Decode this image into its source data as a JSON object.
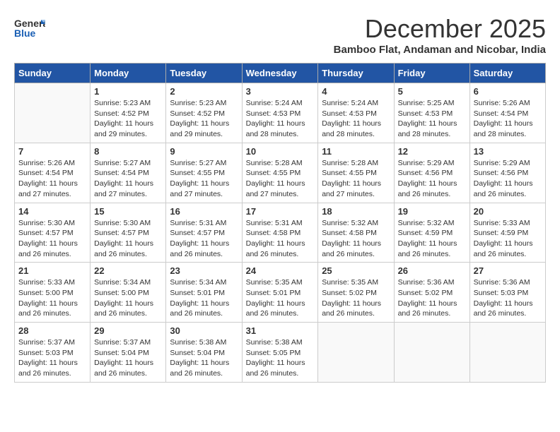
{
  "header": {
    "logo_line1": "General",
    "logo_line2": "Blue",
    "month": "December 2025",
    "location": "Bamboo Flat, Andaman and Nicobar, India"
  },
  "days_of_week": [
    "Sunday",
    "Monday",
    "Tuesday",
    "Wednesday",
    "Thursday",
    "Friday",
    "Saturday"
  ],
  "weeks": [
    [
      {
        "day": "",
        "info": ""
      },
      {
        "day": "1",
        "info": "Sunrise: 5:23 AM\nSunset: 4:52 PM\nDaylight: 11 hours\nand 29 minutes."
      },
      {
        "day": "2",
        "info": "Sunrise: 5:23 AM\nSunset: 4:52 PM\nDaylight: 11 hours\nand 29 minutes."
      },
      {
        "day": "3",
        "info": "Sunrise: 5:24 AM\nSunset: 4:53 PM\nDaylight: 11 hours\nand 28 minutes."
      },
      {
        "day": "4",
        "info": "Sunrise: 5:24 AM\nSunset: 4:53 PM\nDaylight: 11 hours\nand 28 minutes."
      },
      {
        "day": "5",
        "info": "Sunrise: 5:25 AM\nSunset: 4:53 PM\nDaylight: 11 hours\nand 28 minutes."
      },
      {
        "day": "6",
        "info": "Sunrise: 5:26 AM\nSunset: 4:54 PM\nDaylight: 11 hours\nand 28 minutes."
      }
    ],
    [
      {
        "day": "7",
        "info": "Sunrise: 5:26 AM\nSunset: 4:54 PM\nDaylight: 11 hours\nand 27 minutes."
      },
      {
        "day": "8",
        "info": "Sunrise: 5:27 AM\nSunset: 4:54 PM\nDaylight: 11 hours\nand 27 minutes."
      },
      {
        "day": "9",
        "info": "Sunrise: 5:27 AM\nSunset: 4:55 PM\nDaylight: 11 hours\nand 27 minutes."
      },
      {
        "day": "10",
        "info": "Sunrise: 5:28 AM\nSunset: 4:55 PM\nDaylight: 11 hours\nand 27 minutes."
      },
      {
        "day": "11",
        "info": "Sunrise: 5:28 AM\nSunset: 4:55 PM\nDaylight: 11 hours\nand 27 minutes."
      },
      {
        "day": "12",
        "info": "Sunrise: 5:29 AM\nSunset: 4:56 PM\nDaylight: 11 hours\nand 26 minutes."
      },
      {
        "day": "13",
        "info": "Sunrise: 5:29 AM\nSunset: 4:56 PM\nDaylight: 11 hours\nand 26 minutes."
      }
    ],
    [
      {
        "day": "14",
        "info": "Sunrise: 5:30 AM\nSunset: 4:57 PM\nDaylight: 11 hours\nand 26 minutes."
      },
      {
        "day": "15",
        "info": "Sunrise: 5:30 AM\nSunset: 4:57 PM\nDaylight: 11 hours\nand 26 minutes."
      },
      {
        "day": "16",
        "info": "Sunrise: 5:31 AM\nSunset: 4:57 PM\nDaylight: 11 hours\nand 26 minutes."
      },
      {
        "day": "17",
        "info": "Sunrise: 5:31 AM\nSunset: 4:58 PM\nDaylight: 11 hours\nand 26 minutes."
      },
      {
        "day": "18",
        "info": "Sunrise: 5:32 AM\nSunset: 4:58 PM\nDaylight: 11 hours\nand 26 minutes."
      },
      {
        "day": "19",
        "info": "Sunrise: 5:32 AM\nSunset: 4:59 PM\nDaylight: 11 hours\nand 26 minutes."
      },
      {
        "day": "20",
        "info": "Sunrise: 5:33 AM\nSunset: 4:59 PM\nDaylight: 11 hours\nand 26 minutes."
      }
    ],
    [
      {
        "day": "21",
        "info": "Sunrise: 5:33 AM\nSunset: 5:00 PM\nDaylight: 11 hours\nand 26 minutes."
      },
      {
        "day": "22",
        "info": "Sunrise: 5:34 AM\nSunset: 5:00 PM\nDaylight: 11 hours\nand 26 minutes."
      },
      {
        "day": "23",
        "info": "Sunrise: 5:34 AM\nSunset: 5:01 PM\nDaylight: 11 hours\nand 26 minutes."
      },
      {
        "day": "24",
        "info": "Sunrise: 5:35 AM\nSunset: 5:01 PM\nDaylight: 11 hours\nand 26 minutes."
      },
      {
        "day": "25",
        "info": "Sunrise: 5:35 AM\nSunset: 5:02 PM\nDaylight: 11 hours\nand 26 minutes."
      },
      {
        "day": "26",
        "info": "Sunrise: 5:36 AM\nSunset: 5:02 PM\nDaylight: 11 hours\nand 26 minutes."
      },
      {
        "day": "27",
        "info": "Sunrise: 5:36 AM\nSunset: 5:03 PM\nDaylight: 11 hours\nand 26 minutes."
      }
    ],
    [
      {
        "day": "28",
        "info": "Sunrise: 5:37 AM\nSunset: 5:03 PM\nDaylight: 11 hours\nand 26 minutes."
      },
      {
        "day": "29",
        "info": "Sunrise: 5:37 AM\nSunset: 5:04 PM\nDaylight: 11 hours\nand 26 minutes."
      },
      {
        "day": "30",
        "info": "Sunrise: 5:38 AM\nSunset: 5:04 PM\nDaylight: 11 hours\nand 26 minutes."
      },
      {
        "day": "31",
        "info": "Sunrise: 5:38 AM\nSunset: 5:05 PM\nDaylight: 11 hours\nand 26 minutes."
      },
      {
        "day": "",
        "info": ""
      },
      {
        "day": "",
        "info": ""
      },
      {
        "day": "",
        "info": ""
      }
    ]
  ]
}
